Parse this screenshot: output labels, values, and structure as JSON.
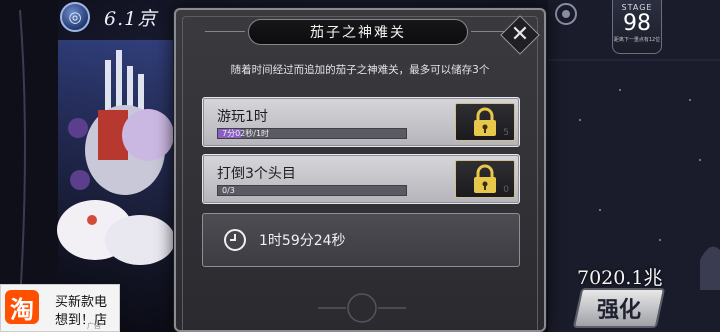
{
  "hud": {
    "currency_amount": "6.1京",
    "currency_icon": "swirl-gem-icon",
    "stage_label": "STAGE",
    "stage_number": "98",
    "stage_note": "距离下一重点有12位",
    "gold_amount": "7020.1兆",
    "upgrade_label": "强化"
  },
  "ad": {
    "logo_text": "淘",
    "line1": "买新款电",
    "line2": "想到！店",
    "mark": "广告"
  },
  "modal": {
    "title": "茄子之神难关",
    "close_icon": "close-icon",
    "description": "随着时间经过而追加的茄子之神难关，最多可以储存3个",
    "tasks": [
      {
        "label": "游玩1时",
        "progress_text": "7分02秒/1时",
        "progress_fraction": 0.12,
        "locked": true,
        "count": "5"
      },
      {
        "label": "打倒3个头目",
        "progress_text": "0/3",
        "progress_fraction": 0,
        "locked": true,
        "count": "0"
      }
    ],
    "timer": "1时59分24秒"
  },
  "colors": {
    "progress_fill": "#8b5fbf",
    "lock_gold": "#e8c84a",
    "modal_bg": "#333337"
  }
}
